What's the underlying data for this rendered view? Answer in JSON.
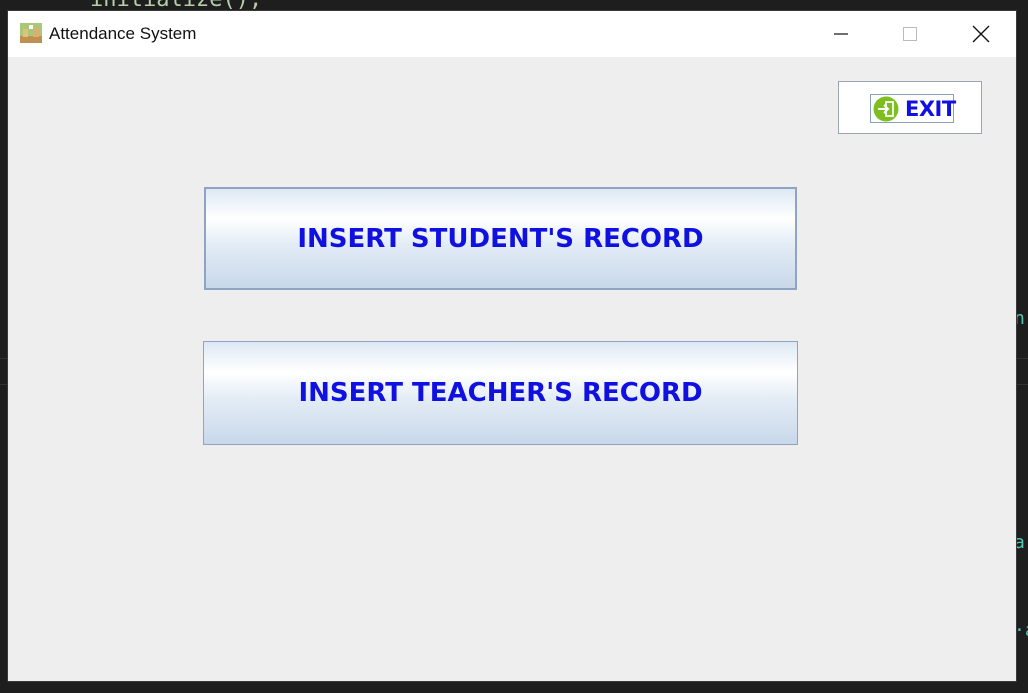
{
  "background": {
    "code_top": "initialize();",
    "edge_chars": [
      "n",
      "a",
      "·a"
    ]
  },
  "window": {
    "title": "Attendance System",
    "app_icon": "app-icon",
    "controls": [
      "minimize-icon",
      "maximize-icon",
      "close-icon"
    ]
  },
  "exit_button": {
    "label": "EXIT",
    "icon": "exit-door-icon",
    "icon_color": "#7cbf1e"
  },
  "buttons": {
    "student": "INSERT STUDENT'S RECORD",
    "teacher": "INSERT TEACHER'S RECORD"
  },
  "colors": {
    "label": "#1010e0",
    "window_bg": "#eeeeee"
  }
}
